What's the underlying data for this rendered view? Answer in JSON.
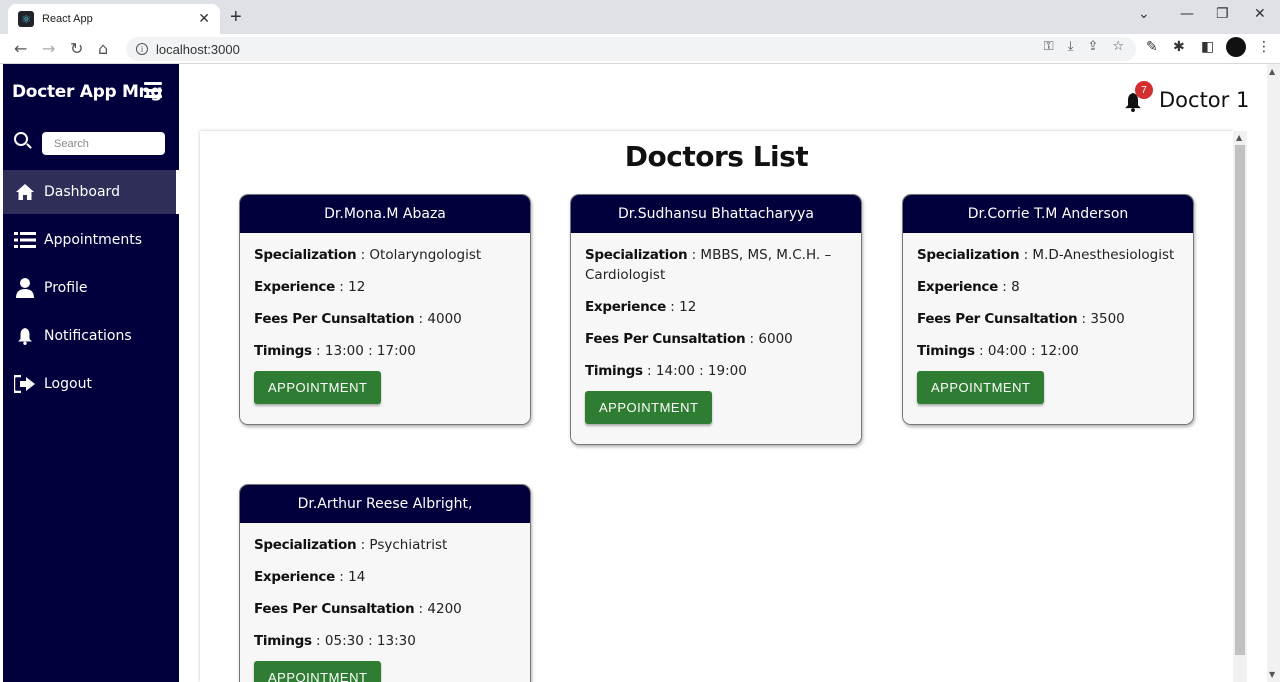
{
  "browser": {
    "tab_title": "React App",
    "url": "localhost:3000"
  },
  "sidebar": {
    "brand": "Docter App Mng",
    "search_placeholder": "Search",
    "items": [
      {
        "label": "Dashboard",
        "icon": "home-icon",
        "active": true
      },
      {
        "label": "Appointments",
        "icon": "list-icon",
        "active": false
      },
      {
        "label": "Profile",
        "icon": "user-icon",
        "active": false
      },
      {
        "label": "Notifications",
        "icon": "bell-icon",
        "active": false
      },
      {
        "label": "Logout",
        "icon": "logout-icon",
        "active": false
      }
    ]
  },
  "header": {
    "notification_count": "7",
    "user_name": "Doctor 1"
  },
  "main": {
    "title": "Doctors List",
    "labels": {
      "specialization": "Specialization",
      "experience": "Experience",
      "fees": "Fees Per Cunsaltation",
      "timings": "Timings",
      "button": "APPOINTMENT"
    },
    "doctors": [
      {
        "name": "Dr.Mona.M Abaza",
        "specialization": "Otolaryngologist",
        "experience": "12",
        "fees": "4000",
        "timings": "13:00 : 17:00"
      },
      {
        "name": "Dr.Sudhansu Bhattacharyya",
        "specialization": "MBBS, MS, M.C.H. – Cardiologist",
        "experience": "12",
        "fees": "6000",
        "timings": "14:00 : 19:00"
      },
      {
        "name": "Dr.Corrie T.M Anderson",
        "specialization": "M.D-Anesthesiologist",
        "experience": "8",
        "fees": "3500",
        "timings": "04:00 : 12:00"
      },
      {
        "name": "Dr.Arthur Reese Albright,",
        "specialization": "Psychiatrist",
        "experience": "14",
        "fees": "4200",
        "timings": "05:30 : 13:30"
      }
    ]
  },
  "colors": {
    "sidebar_bg": "#01003c",
    "card_header_bg": "#01003c",
    "button_bg": "#2e7d32",
    "badge_bg": "#d32f2f"
  }
}
